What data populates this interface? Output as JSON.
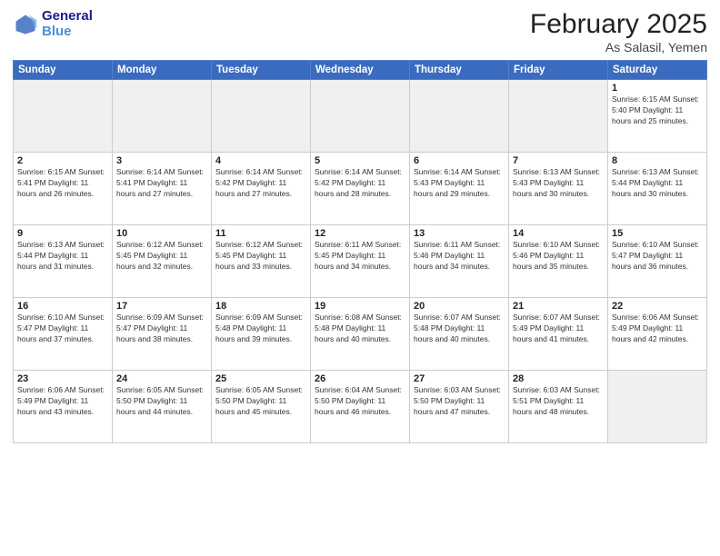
{
  "logo": {
    "line1": "General",
    "line2": "Blue"
  },
  "title": "February 2025",
  "subtitle": "As Salasil, Yemen",
  "weekdays": [
    "Sunday",
    "Monday",
    "Tuesday",
    "Wednesday",
    "Thursday",
    "Friday",
    "Saturday"
  ],
  "weeks": [
    [
      {
        "day": "",
        "info": ""
      },
      {
        "day": "",
        "info": ""
      },
      {
        "day": "",
        "info": ""
      },
      {
        "day": "",
        "info": ""
      },
      {
        "day": "",
        "info": ""
      },
      {
        "day": "",
        "info": ""
      },
      {
        "day": "1",
        "info": "Sunrise: 6:15 AM\nSunset: 5:40 PM\nDaylight: 11 hours and 25 minutes."
      }
    ],
    [
      {
        "day": "2",
        "info": "Sunrise: 6:15 AM\nSunset: 5:41 PM\nDaylight: 11 hours and 26 minutes."
      },
      {
        "day": "3",
        "info": "Sunrise: 6:14 AM\nSunset: 5:41 PM\nDaylight: 11 hours and 27 minutes."
      },
      {
        "day": "4",
        "info": "Sunrise: 6:14 AM\nSunset: 5:42 PM\nDaylight: 11 hours and 27 minutes."
      },
      {
        "day": "5",
        "info": "Sunrise: 6:14 AM\nSunset: 5:42 PM\nDaylight: 11 hours and 28 minutes."
      },
      {
        "day": "6",
        "info": "Sunrise: 6:14 AM\nSunset: 5:43 PM\nDaylight: 11 hours and 29 minutes."
      },
      {
        "day": "7",
        "info": "Sunrise: 6:13 AM\nSunset: 5:43 PM\nDaylight: 11 hours and 30 minutes."
      },
      {
        "day": "8",
        "info": "Sunrise: 6:13 AM\nSunset: 5:44 PM\nDaylight: 11 hours and 30 minutes."
      }
    ],
    [
      {
        "day": "9",
        "info": "Sunrise: 6:13 AM\nSunset: 5:44 PM\nDaylight: 11 hours and 31 minutes."
      },
      {
        "day": "10",
        "info": "Sunrise: 6:12 AM\nSunset: 5:45 PM\nDaylight: 11 hours and 32 minutes."
      },
      {
        "day": "11",
        "info": "Sunrise: 6:12 AM\nSunset: 5:45 PM\nDaylight: 11 hours and 33 minutes."
      },
      {
        "day": "12",
        "info": "Sunrise: 6:11 AM\nSunset: 5:45 PM\nDaylight: 11 hours and 34 minutes."
      },
      {
        "day": "13",
        "info": "Sunrise: 6:11 AM\nSunset: 5:46 PM\nDaylight: 11 hours and 34 minutes."
      },
      {
        "day": "14",
        "info": "Sunrise: 6:10 AM\nSunset: 5:46 PM\nDaylight: 11 hours and 35 minutes."
      },
      {
        "day": "15",
        "info": "Sunrise: 6:10 AM\nSunset: 5:47 PM\nDaylight: 11 hours and 36 minutes."
      }
    ],
    [
      {
        "day": "16",
        "info": "Sunrise: 6:10 AM\nSunset: 5:47 PM\nDaylight: 11 hours and 37 minutes."
      },
      {
        "day": "17",
        "info": "Sunrise: 6:09 AM\nSunset: 5:47 PM\nDaylight: 11 hours and 38 minutes."
      },
      {
        "day": "18",
        "info": "Sunrise: 6:09 AM\nSunset: 5:48 PM\nDaylight: 11 hours and 39 minutes."
      },
      {
        "day": "19",
        "info": "Sunrise: 6:08 AM\nSunset: 5:48 PM\nDaylight: 11 hours and 40 minutes."
      },
      {
        "day": "20",
        "info": "Sunrise: 6:07 AM\nSunset: 5:48 PM\nDaylight: 11 hours and 40 minutes."
      },
      {
        "day": "21",
        "info": "Sunrise: 6:07 AM\nSunset: 5:49 PM\nDaylight: 11 hours and 41 minutes."
      },
      {
        "day": "22",
        "info": "Sunrise: 6:06 AM\nSunset: 5:49 PM\nDaylight: 11 hours and 42 minutes."
      }
    ],
    [
      {
        "day": "23",
        "info": "Sunrise: 6:06 AM\nSunset: 5:49 PM\nDaylight: 11 hours and 43 minutes."
      },
      {
        "day": "24",
        "info": "Sunrise: 6:05 AM\nSunset: 5:50 PM\nDaylight: 11 hours and 44 minutes."
      },
      {
        "day": "25",
        "info": "Sunrise: 6:05 AM\nSunset: 5:50 PM\nDaylight: 11 hours and 45 minutes."
      },
      {
        "day": "26",
        "info": "Sunrise: 6:04 AM\nSunset: 5:50 PM\nDaylight: 11 hours and 46 minutes."
      },
      {
        "day": "27",
        "info": "Sunrise: 6:03 AM\nSunset: 5:50 PM\nDaylight: 11 hours and 47 minutes."
      },
      {
        "day": "28",
        "info": "Sunrise: 6:03 AM\nSunset: 5:51 PM\nDaylight: 11 hours and 48 minutes."
      },
      {
        "day": "",
        "info": ""
      }
    ]
  ]
}
